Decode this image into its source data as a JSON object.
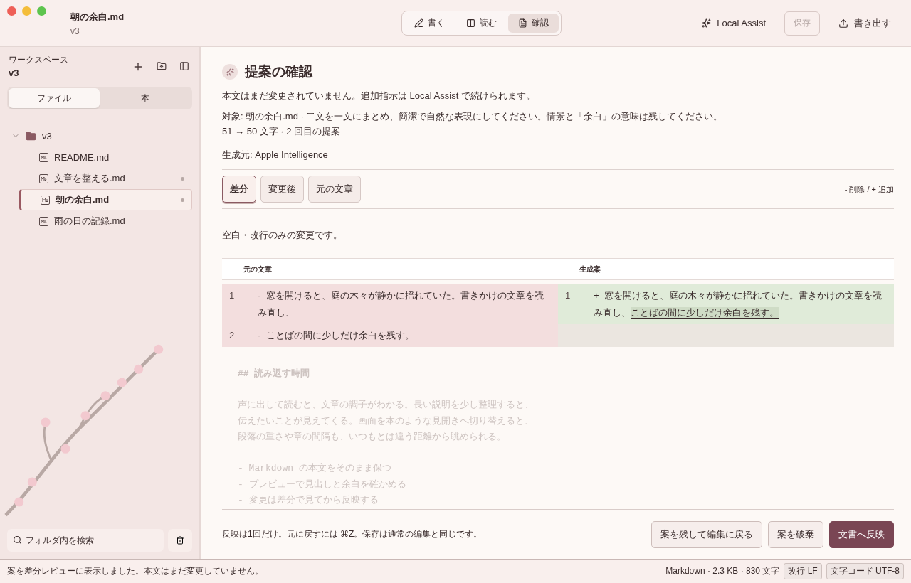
{
  "window": {
    "title": "朝の余白.md",
    "subtitle": "v3"
  },
  "mode_tabs": [
    {
      "label": "書く",
      "kind": "write",
      "selected": false
    },
    {
      "label": "読む",
      "kind": "read",
      "selected": false
    },
    {
      "label": "確認",
      "kind": "review",
      "selected": true
    }
  ],
  "toolbar": {
    "assist": "Local Assist",
    "save": {
      "label": "保存",
      "disabled": true
    },
    "export": "書き出す"
  },
  "sidebar": {
    "caption": "ワークスペース",
    "workspace": "v3",
    "segments": [
      {
        "label": "ファイル",
        "selected": true
      },
      {
        "label": "本",
        "selected": false
      }
    ],
    "tree": [
      {
        "name": "v3",
        "kind": "folder",
        "expanded": true,
        "children": [
          {
            "name": "README.md",
            "kind": "file",
            "modified": false,
            "selected": false
          },
          {
            "name": "文章を整える.md",
            "kind": "file",
            "modified": true,
            "selected": false
          },
          {
            "name": "朝の余白.md",
            "kind": "file",
            "modified": true,
            "selected": true
          },
          {
            "name": "雨の日の記録.md",
            "kind": "file",
            "modified": false,
            "selected": false
          }
        ]
      }
    ],
    "search": {
      "placeholder": "フォルダ内を検索"
    }
  },
  "review": {
    "title": "提案の確認",
    "notice": "本文はまだ変更されていません。追加指示は Local Assist で続けられます。",
    "target": "対象: 朝の余白.md · 二文を一文にまとめ、簡潔で自然な表現にしてください。情景と「余白」の意味は残してください。",
    "stats": "51 → 50 文字 · 2 回目の提案",
    "source": "生成元: Apple Intelligence",
    "view_tabs": [
      {
        "label": "差分",
        "selected": true
      },
      {
        "label": "変更後",
        "selected": false
      },
      {
        "label": "元の文章",
        "selected": false
      }
    ],
    "legend": "- 削除 / + 追加",
    "change_note": "空白・改行のみの変更です。",
    "columns": [
      "元の文章",
      "生成案"
    ],
    "left": [
      {
        "number": "1",
        "sign": "-",
        "text": "窓を開けると、庭の木々が静かに揺れていた。書きかけの文章を読み直し、"
      },
      {
        "number": "2",
        "sign": "-",
        "text": "ことばの間に少しだけ余白を残す。"
      }
    ],
    "right": [
      {
        "number": "1",
        "sign": "+",
        "text": "窓を開けると、庭の木々が静かに揺れていた。書きかけの文章を読み直し、",
        "highlight": "ことばの間に少しだけ余白を残す。"
      }
    ],
    "footer_note": "反映は1回だけ。元に戻すには ⌘Z。保存は通常の編集と同じです。",
    "buttons": [
      {
        "label": "案を残して編集に戻る",
        "kind": "secondary"
      },
      {
        "label": "案を破棄",
        "kind": "secondary"
      },
      {
        "label": "文書へ反映",
        "kind": "primary"
      }
    ]
  },
  "background_editor": [
    {
      "text": "## 読み返す時間",
      "kind": "heading"
    },
    {
      "kind": "blank"
    },
    {
      "text": "声に出して読むと、文章の調子がわかる。長い説明を少し整理すると、",
      "kind": "text"
    },
    {
      "text": "伝えたいことが見えてくる。画面を本のような見開きへ切り替えると、",
      "kind": "text"
    },
    {
      "text": "段落の重さや章の間隔も、いつもとは違う距離から眺められる。",
      "kind": "text"
    },
    {
      "kind": "blank"
    },
    {
      "text": "- Markdown の本文をそのまま保つ",
      "kind": "list"
    },
    {
      "text": "- プレビューで見出しと余白を確かめる",
      "kind": "list"
    },
    {
      "text": "- 変更は差分で見てから反映する",
      "kind": "list"
    }
  ],
  "status_bar": {
    "message": "案を差分レビューに表示しました。本文はまだ変更していません。",
    "info": "Markdown · 2.3 KB · 830 文字",
    "badges": [
      "改行 LF",
      "文字コード UTF-8"
    ]
  }
}
